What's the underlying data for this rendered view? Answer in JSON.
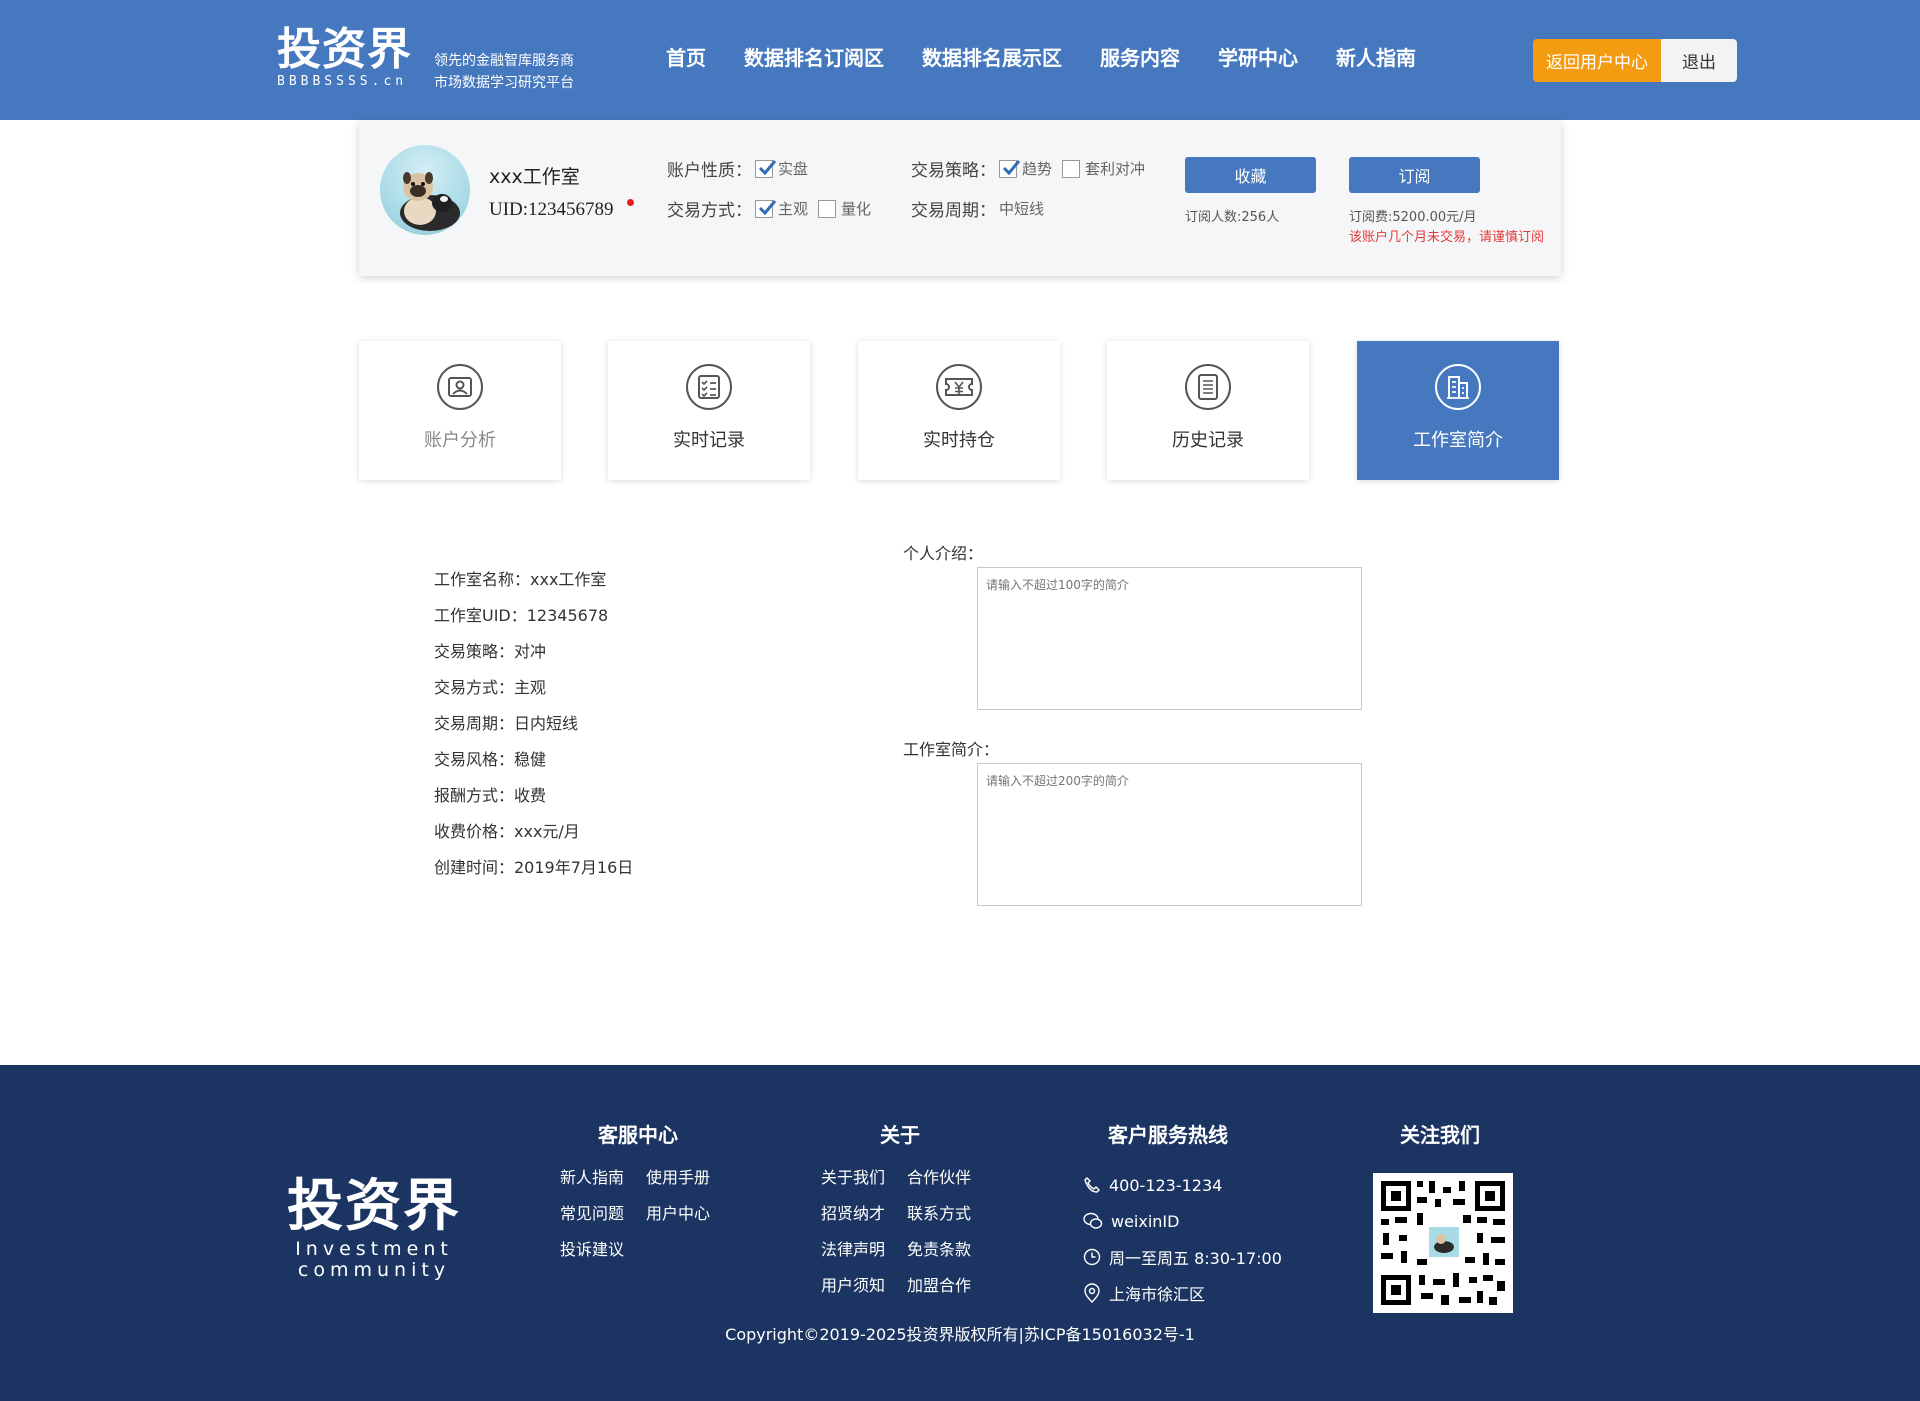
{
  "header": {
    "logo_text": "投资界",
    "logo_domain": "BBBBSSSS.cn",
    "tagline_1": "领先的金融智库服务商",
    "tagline_2": "市场数据学习研究平台",
    "nav": [
      "首页",
      "数据排名订阅区",
      "数据排名展示区",
      "服务内容",
      "学研中心",
      "新人指南"
    ],
    "return_button": "返回用户中心",
    "logout_button": "退出"
  },
  "profile": {
    "name": "xxx工作室",
    "uid": "UID:123456789",
    "account_type_label": "账户性质：",
    "account_type_options": [
      {
        "label": "实盘",
        "checked": true
      }
    ],
    "trade_method_label": "交易方式：",
    "trade_method_options": [
      {
        "label": "主观",
        "checked": true
      },
      {
        "label": "量化",
        "checked": false
      }
    ],
    "strategy_label": "交易策略：",
    "strategy_options": [
      {
        "label": "趋势",
        "checked": true
      },
      {
        "label": "套利对冲",
        "checked": false
      }
    ],
    "period_label": "交易周期：",
    "period_value": "中短线",
    "favorite_button": "收藏",
    "subscribe_button": "订阅",
    "subscriber_count": "订阅人数:256人",
    "subscription_fee": "订阅费:5200.00元/月",
    "warning": "该账户几个月未交易，请谨慎订阅"
  },
  "tabs": [
    {
      "label": "账户分析",
      "icon": "id-card-icon"
    },
    {
      "label": "实时记录",
      "icon": "checklist-icon"
    },
    {
      "label": "实时持仓",
      "icon": "yuan-ticket-icon"
    },
    {
      "label": "历史记录",
      "icon": "scroll-icon"
    },
    {
      "label": "工作室简介",
      "icon": "building-doc-icon"
    }
  ],
  "info": [
    "工作室名称：xxx工作室",
    "工作室UID：12345678",
    "交易策略：对冲",
    "交易方式：主观",
    "交易周期：日内短线",
    "交易风格：稳健",
    "报酬方式：收费",
    "收费价格：xxx元/月",
    "创建时间：2019年7月16日"
  ],
  "intro": {
    "personal_label": "个人介绍：",
    "personal_placeholder": "请输入不超过100字的简介",
    "studio_label": "工作室简介：",
    "studio_placeholder": "请输入不超过200字的简介"
  },
  "footer": {
    "logo_text": "投资界",
    "logo_en_1": "Investment",
    "logo_en_2": "community",
    "service_title": "客服中心",
    "service_links": [
      "新人指南",
      "使用手册",
      "常见问题",
      "用户中心",
      "投诉建议"
    ],
    "about_title": "关于",
    "about_links": [
      "关于我们",
      "合作伙伴",
      "招贤纳才",
      "联系方式",
      "法律声明",
      "免责条款",
      "用户须知",
      "加盟合作"
    ],
    "hotline_title": "客户服务热线",
    "phone": "400-123-1234",
    "wechat": "weixinID",
    "hours": "周一至周五 8:30-17:00",
    "address": "上海市徐汇区",
    "follow_title": "关注我们",
    "copyright": "Copyright©2019-2025投资界版权所有|苏ICP备15016032号-1"
  },
  "colors": {
    "primary": "#4578be",
    "accent_orange": "#f39c12",
    "footer_bg": "#1c3461",
    "warning": "#e23b3b"
  }
}
